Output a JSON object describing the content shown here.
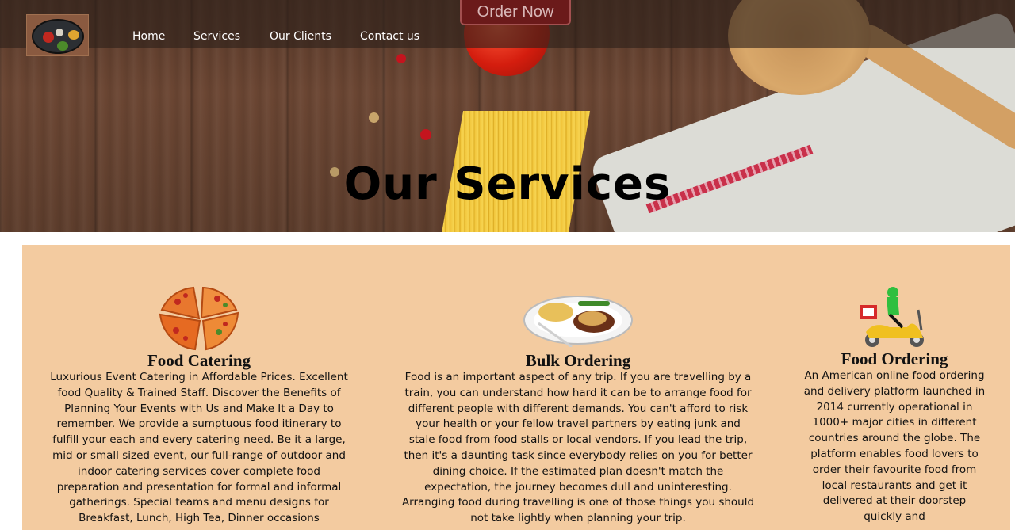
{
  "nav": {
    "links": [
      "Home",
      "Services",
      "Our Clients",
      "Contact us"
    ],
    "order_label": "Order Now"
  },
  "hero": {
    "title": "Our Services"
  },
  "services": [
    {
      "title": "Food Catering",
      "icon": "pizza-icon",
      "text": "Luxurious Event Catering in Affordable Prices. Excellent food Quality & Trained Staff. Discover the Benefits of Planning Your Events with Us and Make It a Day to remember. We provide a sumptuous food itinerary to fulfill your each and every catering need. Be it a large, mid or small sized event, our full-range of outdoor and indoor catering services cover complete food preparation and presentation for formal and informal gatherings. Special teams and menu designs for Breakfast, Lunch, High Tea, Dinner occasions"
    },
    {
      "title": "Bulk Ordering",
      "icon": "food-plate-icon",
      "text": "Food is an important aspect of any trip. If you are travelling by a train, you can understand how hard it can be to arrange food for different people with different demands. You can't afford to risk your health or your fellow travel partners by eating junk and stale food from food stalls or local vendors. If you lead the trip, then it's a daunting task since everybody relies on you for better dining choice. If the estimated plan doesn't match the expectation, the journey becomes dull and uninteresting. Arranging food during travelling is one of those things you should not take lightly when planning your trip."
    },
    {
      "title": "Food Ordering",
      "icon": "delivery-scooter-icon",
      "text": "An American online food ordering and delivery platform launched in 2014 currently operational in 1000+ major cities in different countries around the globe. The platform enables food lovers to order their favourite food from local restaurants and get it delivered at their doorstep quickly and"
    }
  ],
  "colors": {
    "section_bg": "#f3cba0",
    "order_button": "#6b1a1a",
    "navbar": "rgba(45,32,26,0.62)"
  }
}
